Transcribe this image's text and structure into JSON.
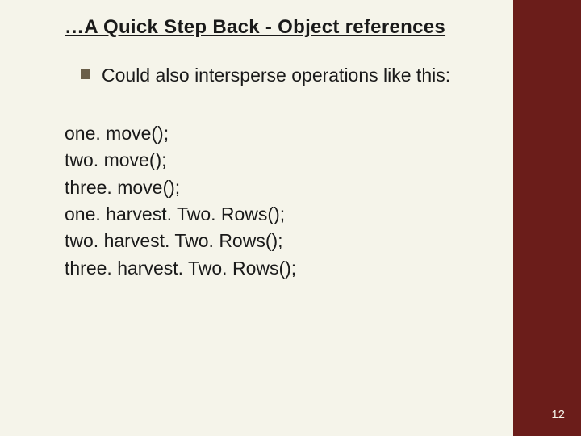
{
  "title": "…A Quick Step Back - Object references",
  "bullet": "Could also intersperse operations like this:",
  "code": {
    "l1": "one. move();",
    "l2": "two. move();",
    "l3": "three. move();",
    "l4": "one. harvest. Two. Rows();",
    "l5": "two. harvest. Two. Rows();",
    "l6": "three. harvest. Two. Rows();"
  },
  "page_number": "12"
}
